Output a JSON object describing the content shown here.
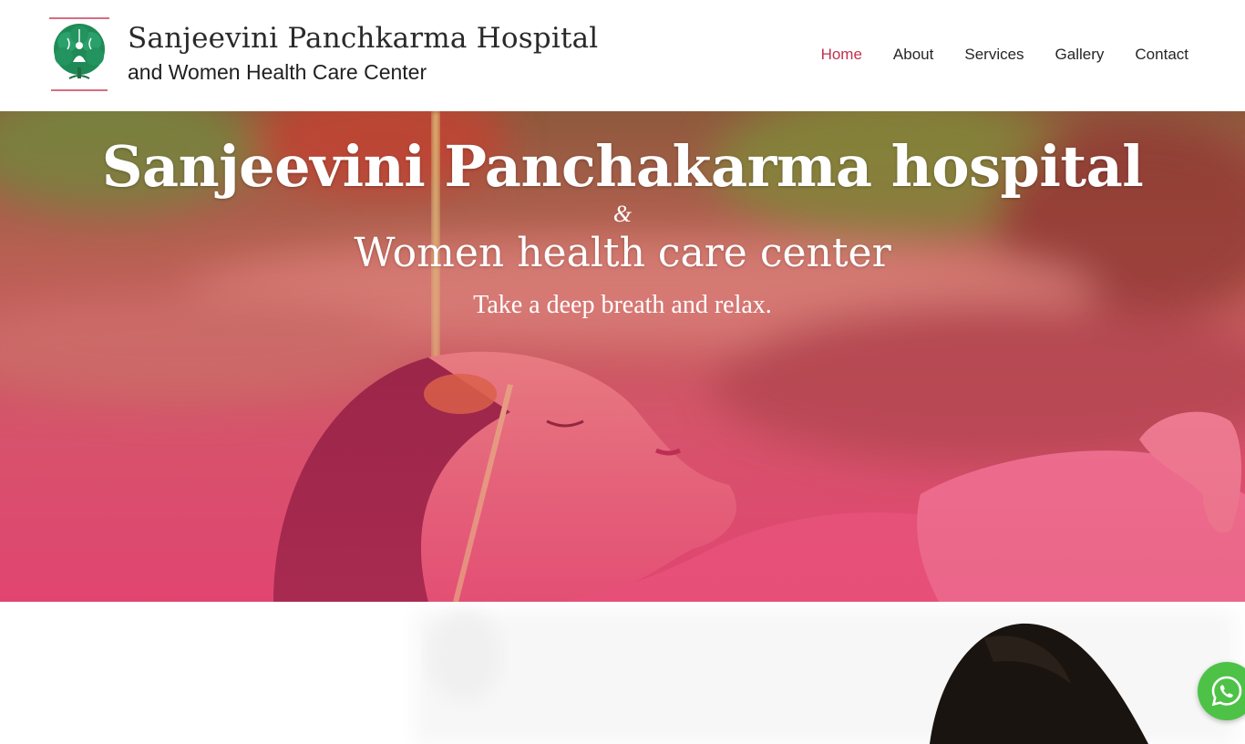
{
  "header": {
    "brand_title": "Sanjeevini Panchkarma Hospital",
    "brand_subtitle": "and Women Health Care Center",
    "logo_icon": "tree-of-life-logo-icon",
    "nav": [
      {
        "label": "Home",
        "active": true
      },
      {
        "label": "About",
        "active": false
      },
      {
        "label": "Services",
        "active": false
      },
      {
        "label": "Gallery",
        "active": false
      },
      {
        "label": "Contact",
        "active": false
      }
    ]
  },
  "hero": {
    "title": "Sanjeevini Panchakarma hospital",
    "ampersand": "&",
    "subtitle": "Women health care center",
    "tagline": "Take a deep breath and relax."
  },
  "floating": {
    "whatsapp_icon": "whatsapp-icon"
  },
  "colors": {
    "nav_active": "#c2304d",
    "nav_text": "#262626",
    "brand_green": "#1f8a55",
    "hero_overlay": "#e04a72",
    "whatsapp_green": "#4dc247"
  }
}
